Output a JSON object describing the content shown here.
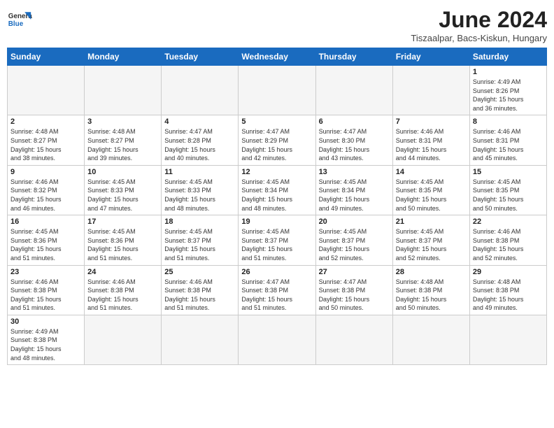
{
  "header": {
    "logo_general": "General",
    "logo_blue": "Blue",
    "title": "June 2024",
    "subtitle": "Tiszaalpar, Bacs-Kiskun, Hungary"
  },
  "weekdays": [
    "Sunday",
    "Monday",
    "Tuesday",
    "Wednesday",
    "Thursday",
    "Friday",
    "Saturday"
  ],
  "weeks": [
    [
      {
        "day": "",
        "info": ""
      },
      {
        "day": "",
        "info": ""
      },
      {
        "day": "",
        "info": ""
      },
      {
        "day": "",
        "info": ""
      },
      {
        "day": "",
        "info": ""
      },
      {
        "day": "",
        "info": ""
      },
      {
        "day": "1",
        "info": "Sunrise: 4:49 AM\nSunset: 8:26 PM\nDaylight: 15 hours\nand 36 minutes."
      }
    ],
    [
      {
        "day": "2",
        "info": "Sunrise: 4:48 AM\nSunset: 8:27 PM\nDaylight: 15 hours\nand 38 minutes."
      },
      {
        "day": "3",
        "info": "Sunrise: 4:48 AM\nSunset: 8:27 PM\nDaylight: 15 hours\nand 39 minutes."
      },
      {
        "day": "4",
        "info": "Sunrise: 4:47 AM\nSunset: 8:28 PM\nDaylight: 15 hours\nand 40 minutes."
      },
      {
        "day": "5",
        "info": "Sunrise: 4:47 AM\nSunset: 8:29 PM\nDaylight: 15 hours\nand 42 minutes."
      },
      {
        "day": "6",
        "info": "Sunrise: 4:47 AM\nSunset: 8:30 PM\nDaylight: 15 hours\nand 43 minutes."
      },
      {
        "day": "7",
        "info": "Sunrise: 4:46 AM\nSunset: 8:31 PM\nDaylight: 15 hours\nand 44 minutes."
      },
      {
        "day": "8",
        "info": "Sunrise: 4:46 AM\nSunset: 8:31 PM\nDaylight: 15 hours\nand 45 minutes."
      }
    ],
    [
      {
        "day": "9",
        "info": "Sunrise: 4:46 AM\nSunset: 8:32 PM\nDaylight: 15 hours\nand 46 minutes."
      },
      {
        "day": "10",
        "info": "Sunrise: 4:45 AM\nSunset: 8:33 PM\nDaylight: 15 hours\nand 47 minutes."
      },
      {
        "day": "11",
        "info": "Sunrise: 4:45 AM\nSunset: 8:33 PM\nDaylight: 15 hours\nand 48 minutes."
      },
      {
        "day": "12",
        "info": "Sunrise: 4:45 AM\nSunset: 8:34 PM\nDaylight: 15 hours\nand 48 minutes."
      },
      {
        "day": "13",
        "info": "Sunrise: 4:45 AM\nSunset: 8:34 PM\nDaylight: 15 hours\nand 49 minutes."
      },
      {
        "day": "14",
        "info": "Sunrise: 4:45 AM\nSunset: 8:35 PM\nDaylight: 15 hours\nand 50 minutes."
      },
      {
        "day": "15",
        "info": "Sunrise: 4:45 AM\nSunset: 8:35 PM\nDaylight: 15 hours\nand 50 minutes."
      }
    ],
    [
      {
        "day": "16",
        "info": "Sunrise: 4:45 AM\nSunset: 8:36 PM\nDaylight: 15 hours\nand 51 minutes."
      },
      {
        "day": "17",
        "info": "Sunrise: 4:45 AM\nSunset: 8:36 PM\nDaylight: 15 hours\nand 51 minutes."
      },
      {
        "day": "18",
        "info": "Sunrise: 4:45 AM\nSunset: 8:37 PM\nDaylight: 15 hours\nand 51 minutes."
      },
      {
        "day": "19",
        "info": "Sunrise: 4:45 AM\nSunset: 8:37 PM\nDaylight: 15 hours\nand 51 minutes."
      },
      {
        "day": "20",
        "info": "Sunrise: 4:45 AM\nSunset: 8:37 PM\nDaylight: 15 hours\nand 52 minutes."
      },
      {
        "day": "21",
        "info": "Sunrise: 4:45 AM\nSunset: 8:37 PM\nDaylight: 15 hours\nand 52 minutes."
      },
      {
        "day": "22",
        "info": "Sunrise: 4:46 AM\nSunset: 8:38 PM\nDaylight: 15 hours\nand 52 minutes."
      }
    ],
    [
      {
        "day": "23",
        "info": "Sunrise: 4:46 AM\nSunset: 8:38 PM\nDaylight: 15 hours\nand 51 minutes."
      },
      {
        "day": "24",
        "info": "Sunrise: 4:46 AM\nSunset: 8:38 PM\nDaylight: 15 hours\nand 51 minutes."
      },
      {
        "day": "25",
        "info": "Sunrise: 4:46 AM\nSunset: 8:38 PM\nDaylight: 15 hours\nand 51 minutes."
      },
      {
        "day": "26",
        "info": "Sunrise: 4:47 AM\nSunset: 8:38 PM\nDaylight: 15 hours\nand 51 minutes."
      },
      {
        "day": "27",
        "info": "Sunrise: 4:47 AM\nSunset: 8:38 PM\nDaylight: 15 hours\nand 50 minutes."
      },
      {
        "day": "28",
        "info": "Sunrise: 4:48 AM\nSunset: 8:38 PM\nDaylight: 15 hours\nand 50 minutes."
      },
      {
        "day": "29",
        "info": "Sunrise: 4:48 AM\nSunset: 8:38 PM\nDaylight: 15 hours\nand 49 minutes."
      }
    ],
    [
      {
        "day": "30",
        "info": "Sunrise: 4:49 AM\nSunset: 8:38 PM\nDaylight: 15 hours\nand 48 minutes."
      },
      {
        "day": "",
        "info": ""
      },
      {
        "day": "",
        "info": ""
      },
      {
        "day": "",
        "info": ""
      },
      {
        "day": "",
        "info": ""
      },
      {
        "day": "",
        "info": ""
      },
      {
        "day": "",
        "info": ""
      }
    ]
  ]
}
